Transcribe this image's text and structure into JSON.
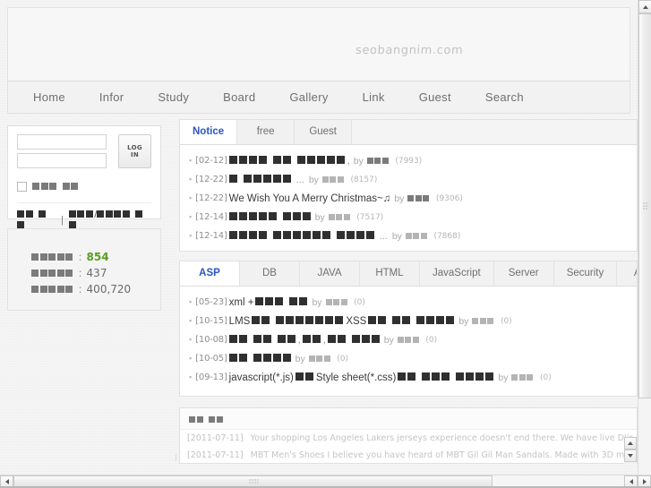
{
  "site": {
    "logo_text": "seobangnim.com"
  },
  "nav": {
    "items": [
      {
        "label": "Home"
      },
      {
        "label": "Infor"
      },
      {
        "label": "Study"
      },
      {
        "label": "Board"
      },
      {
        "label": "Gallery"
      },
      {
        "label": "Link"
      },
      {
        "label": "Guest"
      },
      {
        "label": "Search"
      }
    ]
  },
  "login": {
    "id_placeholder": "",
    "id_value": "",
    "pw_placeholder": "",
    "pw_value": "",
    "submit_label": "LOG IN",
    "remember_label": "■■■ ■■",
    "link_join": "■■ ■■",
    "link_separator": "|",
    "link_find": "■■■/■■■■ ■■"
  },
  "stats": {
    "rows": [
      {
        "label": "■■■■■",
        "value": "854",
        "accent": true
      },
      {
        "label": "■■■■■",
        "value": "437",
        "accent": false
      },
      {
        "label": "■■■■■",
        "value": "400,720",
        "accent": false
      }
    ],
    "accent_color": "#5a9c20"
  },
  "notice_panel": {
    "tabs": [
      {
        "label": "Notice",
        "active": true
      },
      {
        "label": "free",
        "active": false
      },
      {
        "label": "Guest",
        "active": false
      }
    ],
    "rows": [
      {
        "date": "[02-12]",
        "title": "",
        "tofu": 11,
        "trailing": ",",
        "by": "by",
        "hits": "(7993)"
      },
      {
        "date": "[12-22]",
        "title": "",
        "tofu": 6,
        "trailing": "...",
        "by": "by",
        "hits": "(8157)"
      },
      {
        "date": "[12-22]",
        "title": "We Wish You A Merry Christmas~♫",
        "tofu": 0,
        "trailing": "",
        "by": "by",
        "hits": "(9306)"
      },
      {
        "date": "[12-14]",
        "title": "",
        "tofu": 8,
        "trailing": "",
        "by": "by",
        "hits": "(7517)"
      },
      {
        "date": "[12-14]",
        "title": "",
        "tofu": 14,
        "trailing": "...",
        "by": "by",
        "hits": "(7868)"
      }
    ]
  },
  "study_panel": {
    "tabs": [
      {
        "label": "ASP",
        "active": true
      },
      {
        "label": "DB",
        "active": false
      },
      {
        "label": "JAVA",
        "active": false
      },
      {
        "label": "HTML",
        "active": false
      },
      {
        "label": "JavaScript",
        "active": false
      },
      {
        "label": "Server",
        "active": false
      },
      {
        "label": "Security",
        "active": false
      },
      {
        "label": "AJAX",
        "active": false
      }
    ],
    "rows": [
      {
        "date": "[05-23]",
        "title": "xml +",
        "tofu": 5,
        "title2": "",
        "tofu2": 0,
        "by": "by",
        "hits": "(0)"
      },
      {
        "date": "[10-15]",
        "title": "LMS",
        "tofu": 10,
        "title2": "XSS",
        "tofu2": 8,
        "by": "by",
        "hits": "(0)"
      },
      {
        "date": "[10-08]",
        "title": "",
        "tofu": 13,
        "title2": "",
        "tofu2": 0,
        "by": "by",
        "hits": "(0)"
      },
      {
        "date": "[10-05]",
        "title": "",
        "tofu": 6,
        "title2": "",
        "tofu2": 0,
        "by": "by",
        "hits": "(0)"
      },
      {
        "date": "[09-13]",
        "title": "javascript(*.js)",
        "tofu": 2,
        "title2": "Style sheet(*.css)",
        "tofu2": 14,
        "by": "by",
        "hits": "(0)"
      }
    ]
  },
  "recent_panel": {
    "heading": "■■ ■■",
    "rows": [
      {
        "date": "[2011-07-11]",
        "text": "Your shopping Los Angeles Lakers jerseys experience doesn't end there. We have live DJ's spinning their tracks in Bo"
      },
      {
        "date": "[2011-07-11]",
        "text": "MBT Men's Shoes I believe you have heard of MBT Gil Gil Man Sandals. Made with 3D mesh and leather, this leather"
      }
    ]
  },
  "scrollbars": {
    "vertical_outer": {
      "up": "▲",
      "down": "▼"
    },
    "vertical_inner": {
      "up": "▲",
      "down": "▼"
    },
    "horizontal": {
      "left": "◀",
      "right": "▶"
    }
  }
}
